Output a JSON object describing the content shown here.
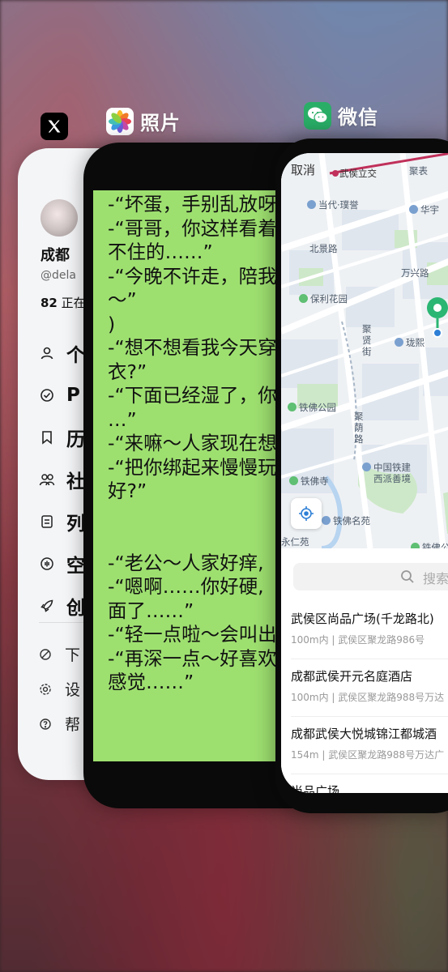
{
  "apps": {
    "x": {
      "icon": "x-logo-icon"
    },
    "photos": {
      "label": "照片",
      "icon": "photos-flower-icon"
    },
    "wechat": {
      "label": "微信",
      "icon": "wechat-bubbles-icon"
    }
  },
  "x_card": {
    "name": "成都",
    "handle": "@dela",
    "count": "82",
    "count_suffix": "正在",
    "menu": [
      {
        "icon": "person-icon",
        "label": "个"
      },
      {
        "icon": "premium-badge-icon",
        "label": "P"
      },
      {
        "icon": "bookmark-icon",
        "label": "历"
      },
      {
        "icon": "communities-icon",
        "label": "社"
      },
      {
        "icon": "list-icon",
        "label": "列"
      },
      {
        "icon": "spaces-icon",
        "label": "空"
      },
      {
        "icon": "rocket-icon",
        "label": "创"
      }
    ],
    "menu2": [
      {
        "icon": "download-icon",
        "label": "下"
      },
      {
        "icon": "settings-icon",
        "label": "设"
      },
      {
        "icon": "help-icon",
        "label": "帮"
      }
    ]
  },
  "photos_card": {
    "lines": [
      "-“坏蛋，手别乱放呀",
      "-“哥哥，你这样看着",
      "不住的……”",
      "-“今晚不许走，陪我",
      "～”",
      ")",
      "-“想不想看我今天穿",
      "衣?”",
      "-“下面已经湿了，你",
      "…”",
      "-“来嘛～人家现在想",
      "-“把你绑起来慢慢玩",
      "好?”",
      "",
      "",
      "-“老公～人家好痒,",
      "-“嗯啊……你好硬,",
      "面了……”",
      "-“轻一点啦～会叫出",
      "-“再深一点～好喜欢",
      "感觉……”"
    ]
  },
  "wechat_card": {
    "cancel": "取消",
    "map_labels": {
      "wuhou_lijiao": "武侯立交",
      "jubao": "聚表",
      "dangdai_puyu": "当代·璞誉",
      "huayu": "华宇",
      "beijinglu": "北景路",
      "yang": "阳",
      "wanxinglu": "万兴路",
      "baoli_huayuan": "保利花园",
      "juxian_jie": "聚贤街",
      "longxi": "珑熙",
      "ju": "聚",
      "tiefo_gongyuan": "铁佛公园",
      "juyin_lu": "聚荫路",
      "tiefo_si": "铁佛寺",
      "zhongguo_tiejian": "中国铁建",
      "xipai_shanjing": "西派善境",
      "tiefo_mingyuan": "铁佛名苑",
      "yongren_yuan": "永仁苑",
      "tiefo_gongyuan2": "铁佛公园"
    },
    "search_placeholder": "搜索",
    "results": [
      {
        "title": "武侯区尚品广场(千龙路北)",
        "subtitle": "100m内 | 武侯区聚龙路986号"
      },
      {
        "title": "成都武侯开元名庭酒店",
        "subtitle": "100m内 | 武侯区聚龙路988号万达"
      },
      {
        "title": "成都武侯大悦城锦江都城酒",
        "subtitle": "154m | 武侯区聚龙路988号万达广"
      },
      {
        "title": "尚品广场",
        "subtitle": ""
      }
    ]
  },
  "colors": {
    "photos_bubble": "#9ee070",
    "wechat_green": "#2aae67",
    "map_bg": "#eef1f4"
  }
}
